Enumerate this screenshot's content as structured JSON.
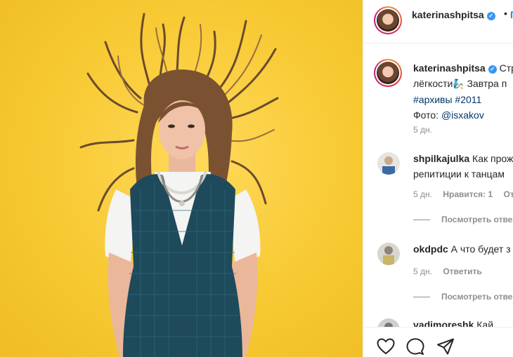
{
  "post": {
    "username": "katerinashpitsa",
    "verified_glyph": "✓",
    "header_dot": "•",
    "header_follow": "П",
    "caption": {
      "line1_rest": "Стр",
      "line2_prefix": "лёгкости",
      "line2_emoji": "🧞",
      "line2_suffix": " Завтра п",
      "hashtags": "#архивы #2011",
      "photo_prefix": "Фото: ",
      "mention": "@isxakov",
      "time": "5 дн."
    },
    "comments": [
      {
        "username": "shpilkajulka",
        "text_line1": "Как прож",
        "text_line2": "репитиции к танцам",
        "time": "5 дн.",
        "likes": "Нравится: 1",
        "reply": "Ответить",
        "view_replies": "Посмотреть отве"
      },
      {
        "username": "okdpdc",
        "text_line1": "А что будет з",
        "time": "5 дн.",
        "reply": "Ответить",
        "view_replies": "Посмотреть отве"
      }
    ],
    "partial_comment": {
      "username": "vadimoreshk",
      "text": "Кай"
    }
  },
  "actions": {
    "like_icon": "heart-icon",
    "comment_icon": "comment-icon",
    "share_icon": "share-icon"
  },
  "colors": {
    "background_photo": "#f7c932",
    "link": "#00376b",
    "follow": "#0095f6",
    "verified": "#3897f0",
    "muted": "#8e8e8e"
  }
}
